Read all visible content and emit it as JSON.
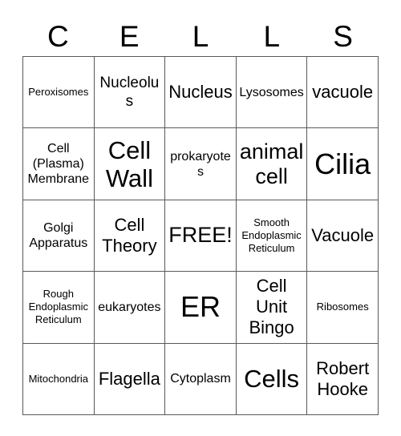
{
  "card": {
    "title": "Cell Unit Bingo",
    "header_letters": [
      "C",
      "E",
      "L",
      "L",
      "S"
    ],
    "columns": 5,
    "rows": 5,
    "border_color": "#595959",
    "background_color": "#ffffff",
    "text_color": "#000000",
    "free_space": "FREE!",
    "free_space_position": {
      "row": 3,
      "column": 3
    }
  },
  "cells": [
    {
      "text": "Peroxisomes",
      "size": "fs-sm"
    },
    {
      "text": "Nucleolus",
      "size": "fs-lg"
    },
    {
      "text": "Nucleus",
      "size": "fs-xl"
    },
    {
      "text": "Lysosomes",
      "size": "fs-md"
    },
    {
      "text": "vacuole",
      "size": "fs-xl"
    },
    {
      "text": "Cell\n(Plasma)\nMembrane",
      "size": "fs-md"
    },
    {
      "text": "Cell\nWall",
      "size": "fs-3xl"
    },
    {
      "text": "prokaryotes",
      "size": "fs-md"
    },
    {
      "text": "animal\ncell",
      "size": "fs-2xl"
    },
    {
      "text": "Cilia",
      "size": "fs-4xl"
    },
    {
      "text": "Golgi\nApparatus",
      "size": "fs-md"
    },
    {
      "text": "Cell\nTheory",
      "size": "fs-xl"
    },
    {
      "text": "FREE!",
      "size": "fs-2xl"
    },
    {
      "text": "Smooth\nEndoplasmic\nReticulum",
      "size": "fs-sm"
    },
    {
      "text": "Vacuole",
      "size": "fs-xl"
    },
    {
      "text": "Rough\nEndoplasmic\nReticulum",
      "size": "fs-sm"
    },
    {
      "text": "eukaryotes",
      "size": "fs-md"
    },
    {
      "text": "ER",
      "size": "fs-4xl"
    },
    {
      "text": "Cell\nUnit\nBingo",
      "size": "fs-xl"
    },
    {
      "text": "Ribosomes",
      "size": "fs-sm"
    },
    {
      "text": "Mitochondria",
      "size": "fs-sm"
    },
    {
      "text": "Flagella",
      "size": "fs-xl"
    },
    {
      "text": "Cytoplasm",
      "size": "fs-md"
    },
    {
      "text": "Cells",
      "size": "fs-3xl"
    },
    {
      "text": "Robert\nHooke",
      "size": "fs-xl"
    }
  ]
}
